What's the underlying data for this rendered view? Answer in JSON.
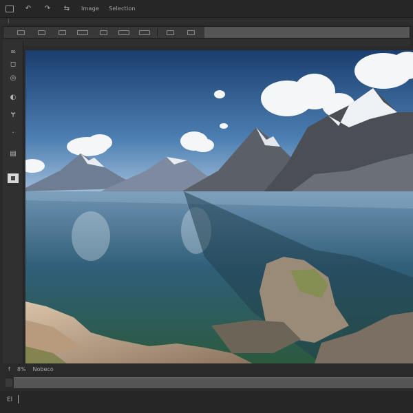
{
  "menubar": {
    "items": [
      "file-icon",
      "undo-icon",
      "redo-icon",
      "share-icon"
    ],
    "menus": [
      "Image",
      "Selection"
    ]
  },
  "toolbar": {
    "buttons": [
      "toolbar-btn-1",
      "toolbar-btn-2",
      "toolbar-btn-3",
      "toolbar-btn-4",
      "toolbar-btn-5",
      "toolbar-btn-6",
      "toolbar-btn-7",
      "toolbar-btn-8",
      "toolbar-btn-9",
      "toolbar-btn-10"
    ]
  },
  "tools": [
    "lasso-icon",
    "select-icon",
    "brush-icon",
    "eraser-icon",
    "text-tool-icon",
    "pen-icon",
    "layers-icon",
    "color-swatch"
  ],
  "statusbar": {
    "items": [
      "f",
      "8%",
      "Nobeco"
    ]
  },
  "footer": {
    "label": "El"
  },
  "colors": {
    "panel": "#303030",
    "toolbar": "#3a3a3a",
    "accent_gray": "#555555",
    "sky": "#234a78",
    "lake": "#2f5e78"
  }
}
